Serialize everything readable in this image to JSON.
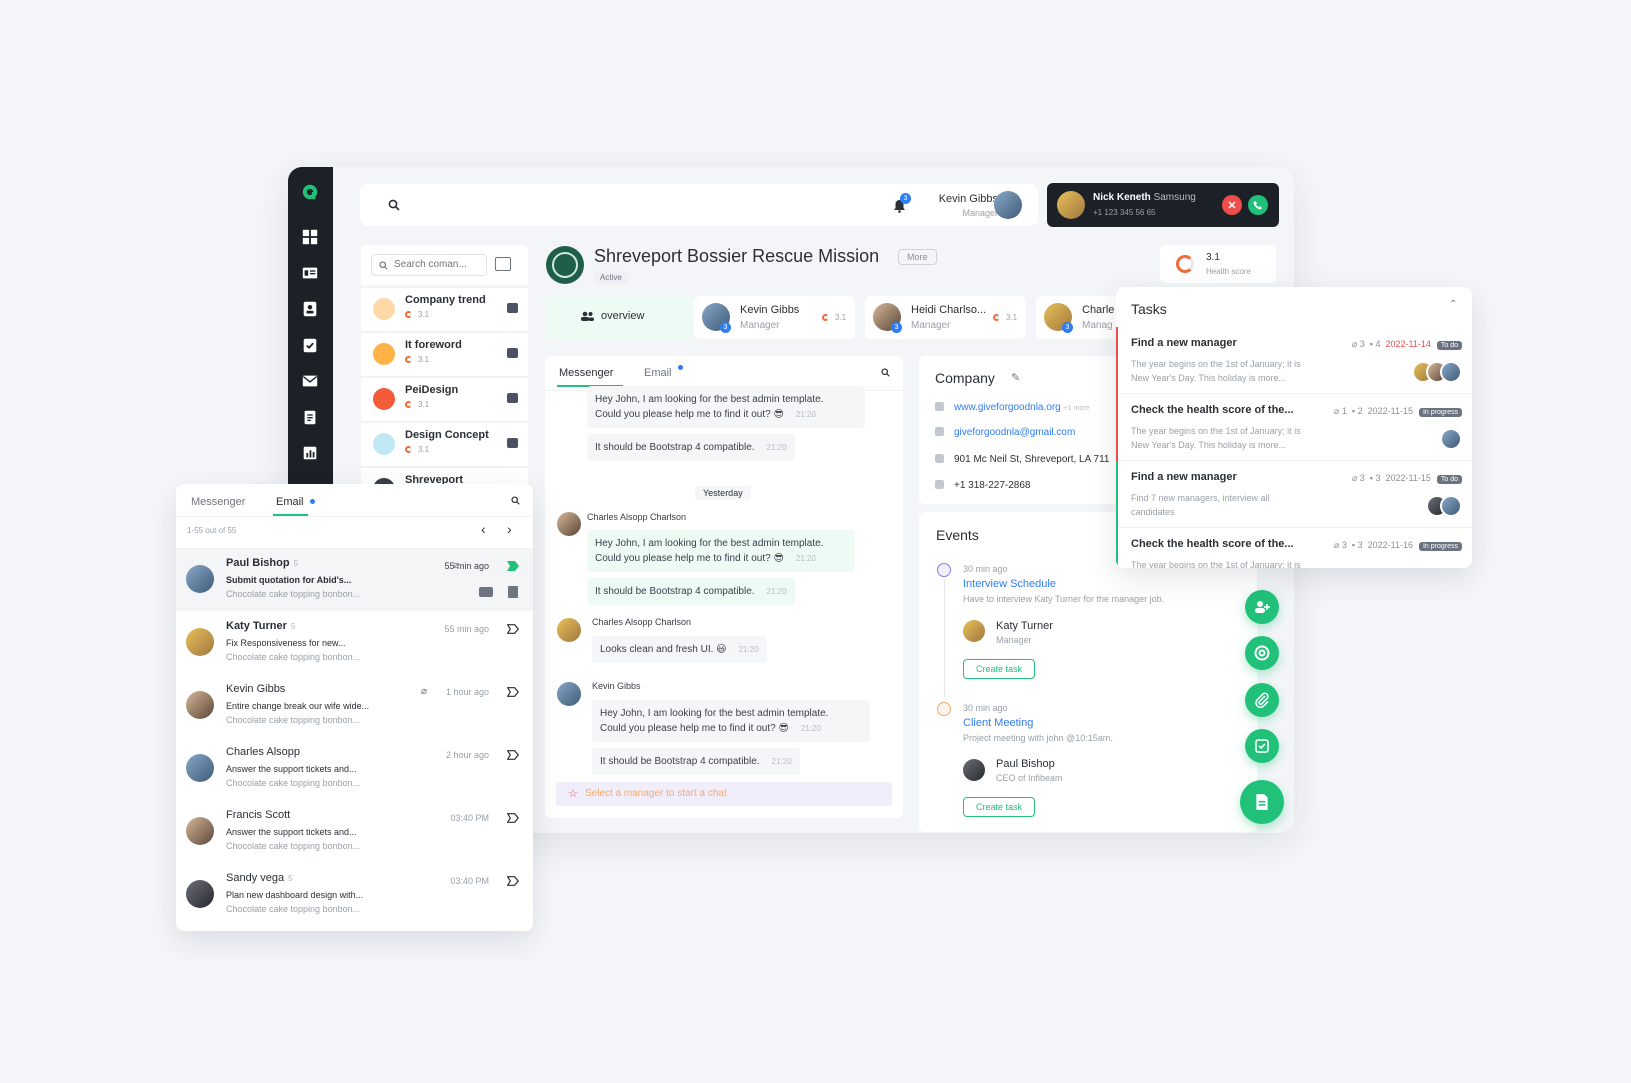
{
  "topbar": {
    "notif_count": "3",
    "user_name": "Kevin Gibbs",
    "user_role": "Manager"
  },
  "call": {
    "name": "Nick Keneth",
    "company": "Samsung",
    "phone": "+1 123 345 56 65"
  },
  "company_list": {
    "search_placeholder": "Search coman...",
    "items": [
      {
        "name": "Company trend",
        "score": "3.1"
      },
      {
        "name": "It foreword",
        "score": "3.1"
      },
      {
        "name": "PeiDesign",
        "score": "3.1"
      },
      {
        "name": "Design Concept",
        "score": "3.1"
      },
      {
        "name": "Shreveport",
        "score": ""
      }
    ]
  },
  "header": {
    "title": "Shreveport Bossier Rescue Mission",
    "more": "More",
    "status": "Active",
    "health_score": "3.1",
    "health_label": "Health score"
  },
  "people": {
    "overview": "overview",
    "items": [
      {
        "name": "Kevin Gibbs",
        "role": "Manager",
        "score": "3.1",
        "badge": "3"
      },
      {
        "name": "Heidi Charlso...",
        "role": "Manager",
        "score": "3.1",
        "badge": "3"
      },
      {
        "name": "Charle",
        "role": "Manag",
        "score": "",
        "badge": "3"
      }
    ]
  },
  "chat": {
    "tab_messenger": "Messenger",
    "tab_email": "Email",
    "messages": {
      "m1": "Hey John, I am looking for the best admin template.",
      "m1b": "Could you please help me to find it out? 😎",
      "m1_time": "21:20",
      "m2": "It should be Bootstrap 4 compatible.",
      "m2_time": "21:20",
      "divider": "Yesterday",
      "s1": "Charles Alsopp Charlson",
      "m3": "Hey John, I am looking for the best admin template.",
      "m3b": "Could you please help me to find it out? 😎",
      "m3_time": "21:20",
      "m4": "It should be Bootstrap 4 compatible.",
      "m4_time": "21:20",
      "s2": "Charles Alsopp Charlson",
      "m5": "Looks clean and fresh UI. 😃",
      "m5_time": "21:20",
      "s3": "Kevin Gibbs",
      "m6": "Hey John, I am looking for the best admin template.",
      "m6b": "Could you please help me to find it out? 😎",
      "m6_time": "21:20",
      "m7": "It should be Bootstrap 4 compatible.",
      "m7_time": "21:20"
    },
    "input_placeholder": "Select a manager to start a chat"
  },
  "company": {
    "title": "Company",
    "website": "www.giveforgoodnla.org",
    "website_more": "+1 more",
    "email": "giveforgoodnla@gmail.com",
    "address": "901 Mc Neil St, Shreveport, LA 711",
    "phone": "+1 318-227-2868"
  },
  "events": {
    "title": "Events",
    "items": [
      {
        "time": "30 min ago",
        "title": "Interview Schedule",
        "desc": "Have to interview Katy Turner for the manager job.",
        "person": "Katy Turner",
        "role": "Manager",
        "button": "Create task"
      },
      {
        "time": "30 min ago",
        "title": "Client Meeting",
        "desc": "Project meeting with john @10:15am.",
        "person": "Paul Bishop",
        "role": "CEO of Infibeam",
        "button": "Create task"
      }
    ]
  },
  "tasks": {
    "title": "Tasks",
    "items": [
      {
        "title": "Find a new manager",
        "desc1": "The year begins on the 1st of January; it is",
        "desc2": "New Year's Day. This holiday is more...",
        "attach": "3",
        "comments": "4",
        "date": "2022-11-14",
        "status": "To do",
        "color": "#ef4c4c"
      },
      {
        "title": "Check the health score of the...",
        "desc1": "The year begins on the 1st of January; it is",
        "desc2": "New Year's Day. This holiday is more...",
        "attach": "1",
        "comments": "2",
        "date": "2022-11-15",
        "status": "In progress",
        "color": "#ef4c4c"
      },
      {
        "title": "Find a new manager",
        "desc1": "Find 7 new managers, interview all",
        "desc2": "candidates",
        "attach": "3",
        "comments": "3",
        "date": "2022-11-15",
        "status": "To do",
        "color": "#21c17a"
      },
      {
        "title": "Check the health score of the...",
        "desc1": "The year begins on the 1st of January; it is",
        "desc2": "",
        "attach": "3",
        "comments": "3",
        "date": "2022-11-16",
        "status": "In progress",
        "color": "#21c17a"
      }
    ]
  },
  "email": {
    "tab_messenger": "Messenger",
    "tab_email": "Email",
    "count": "1-55 out of 55",
    "items": [
      {
        "name": "Paul Bishop",
        "n": "5",
        "subject": "Submit quotation for Abid's...",
        "preview": "Chocolate cake topping bonbon...",
        "time": "55 min ago"
      },
      {
        "name": "Katy Turner",
        "n": "5",
        "subject": "Fix Responsiveness for new...",
        "preview": "Chocolate cake topping bonbon...",
        "time": "55 min ago"
      },
      {
        "name": "Kevin Gibbs",
        "n": "",
        "subject": "Entire change break our wife wide...",
        "preview": "Chocolate cake topping bonbon...",
        "time": "1 hour ago"
      },
      {
        "name": "Charles Alsopp",
        "n": "",
        "subject": "Answer the support tickets and...",
        "preview": "Chocolate cake topping bonbon...",
        "time": "2 hour ago"
      },
      {
        "name": "Francis Scott",
        "n": "",
        "subject": "Answer the support tickets and...",
        "preview": "Chocolate cake topping bonbon...",
        "time": "03:40 PM"
      },
      {
        "name": "Sandy vega",
        "n": "5",
        "subject": "Plan new dashboard design with...",
        "preview": "Chocolate cake topping bonbon...",
        "time": "03:40 PM"
      }
    ]
  },
  "colors": {
    "accent": "#21c17a",
    "dark": "#1c2128",
    "danger": "#ef4c4c",
    "link": "#2f7df6"
  }
}
